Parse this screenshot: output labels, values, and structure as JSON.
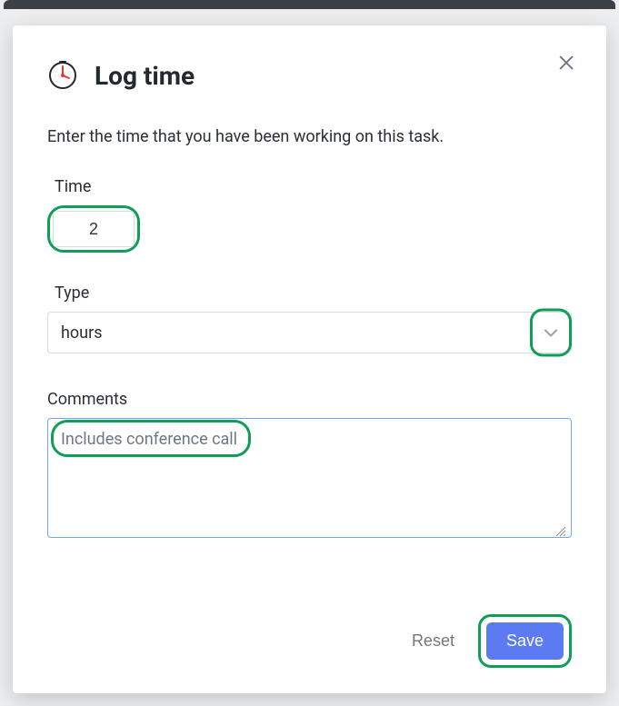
{
  "modal": {
    "title": "Log time",
    "instructions": "Enter the time that you have been working on this task.",
    "fields": {
      "time": {
        "label": "Time",
        "value": "2"
      },
      "type": {
        "label": "Type",
        "selected": "hours"
      },
      "comments": {
        "label": "Comments",
        "value": "Includes conference call"
      }
    },
    "actions": {
      "reset": "Reset",
      "save": "Save"
    }
  }
}
